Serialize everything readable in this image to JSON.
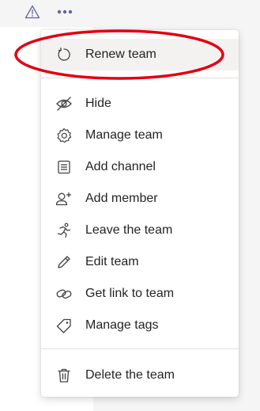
{
  "toolbar": {
    "warning_icon": "warning-triangle-icon",
    "more_icon": "more-options-icon",
    "accent": "#6264a7"
  },
  "menu": {
    "items": [
      {
        "label": "Renew team",
        "icon": "renew-icon"
      },
      {
        "label": "Hide",
        "icon": "eye-off-icon"
      },
      {
        "label": "Manage team",
        "icon": "gear-icon"
      },
      {
        "label": "Add channel",
        "icon": "channel-list-icon"
      },
      {
        "label": "Add member",
        "icon": "add-person-icon"
      },
      {
        "label": "Leave the team",
        "icon": "running-person-icon"
      },
      {
        "label": "Edit team",
        "icon": "pencil-icon"
      },
      {
        "label": "Get link to team",
        "icon": "link-icon"
      },
      {
        "label": "Manage tags",
        "icon": "tag-icon"
      },
      {
        "label": "Delete the team",
        "icon": "trash-icon"
      }
    ]
  },
  "annotation": {
    "color": "#e3000f"
  }
}
